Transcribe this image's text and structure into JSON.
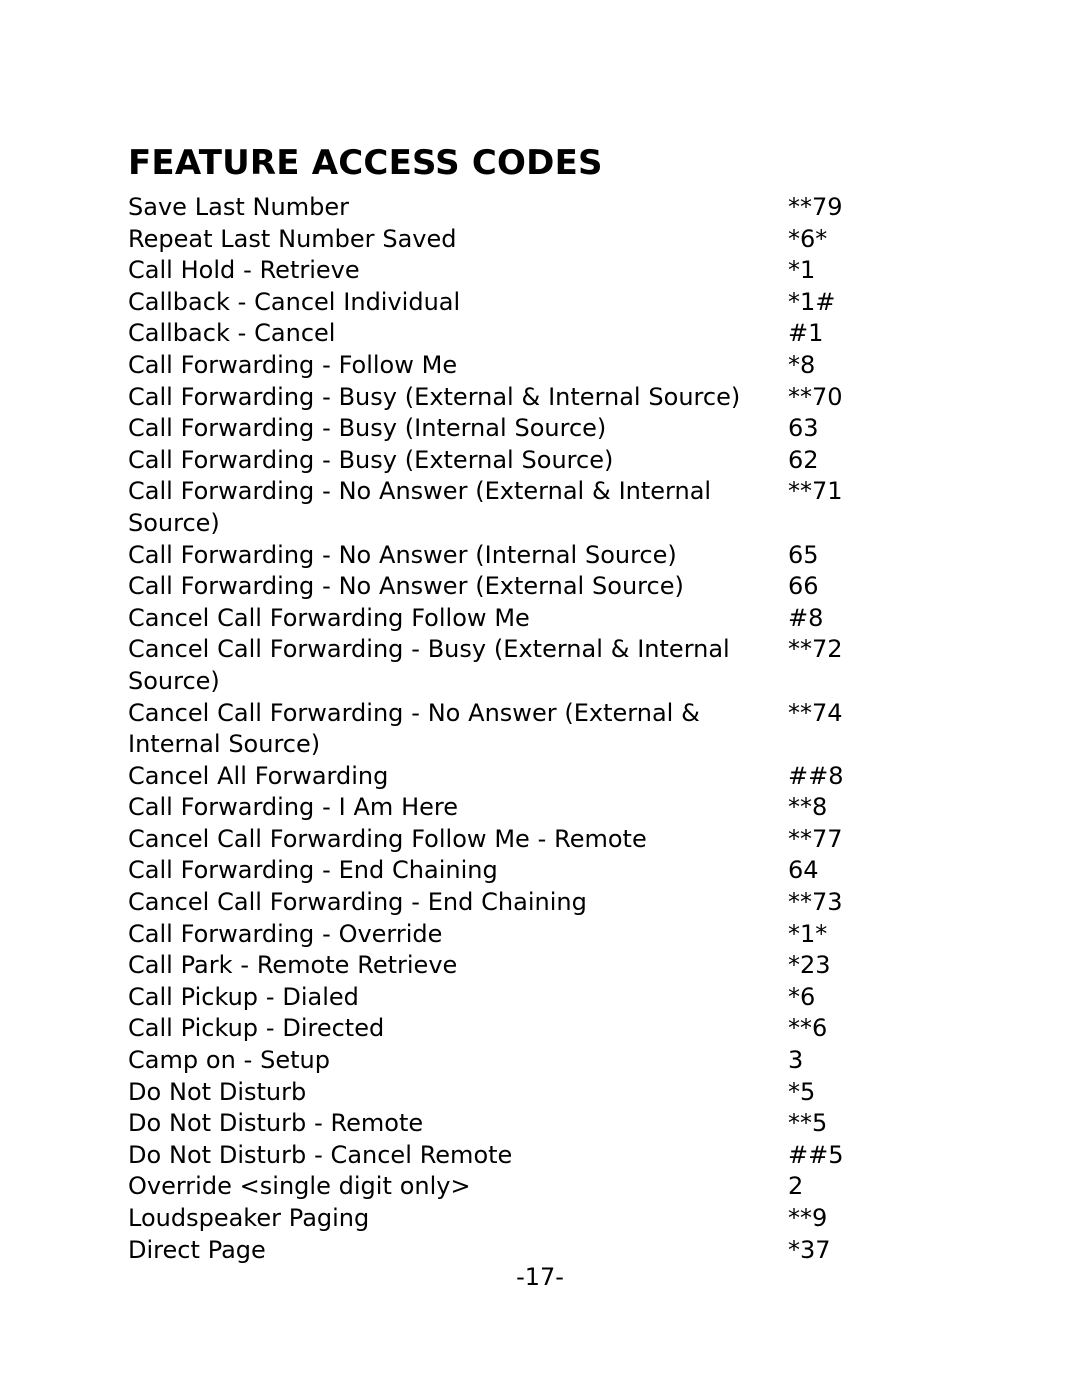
{
  "document": {
    "title": "FEATURE ACCESS CODES",
    "page_number_label": "-17-"
  },
  "feature_codes": {
    "rows": [
      {
        "feature": "Save Last Number",
        "code": "**79"
      },
      {
        "feature": "Repeat Last Number Saved",
        "code": "*6*"
      },
      {
        "feature": "Call Hold - Retrieve",
        "code": "*1"
      },
      {
        "feature": "Callback - Cancel Individual",
        "code": "*1#"
      },
      {
        "feature": "Callback - Cancel",
        "code": "#1"
      },
      {
        "feature": "Call Forwarding - Follow Me",
        "code": "*8"
      },
      {
        "feature": "Call Forwarding - Busy (External & Internal Source)",
        "code": "**70"
      },
      {
        "feature": "Call Forwarding - Busy (Internal Source)",
        "code": "63"
      },
      {
        "feature": "Call Forwarding - Busy (External Source)",
        "code": "62"
      },
      {
        "feature": "Call Forwarding - No Answer (External & Internal Source)",
        "code": "**71"
      },
      {
        "feature": "Call Forwarding - No Answer (Internal Source)",
        "code": "65"
      },
      {
        "feature": "Call Forwarding - No Answer (External Source)",
        "code": "66"
      },
      {
        "feature": "Cancel Call Forwarding Follow Me",
        "code": "#8"
      },
      {
        "feature": "Cancel Call Forwarding - Busy (External & Internal Source)",
        "code": "**72"
      },
      {
        "feature": "Cancel Call Forwarding - No Answer (External & Internal Source)",
        "code": "**74"
      },
      {
        "feature": "Cancel All Forwarding",
        "code": "##8"
      },
      {
        "feature": "Call Forwarding - I Am Here",
        "code": "**8"
      },
      {
        "feature": "Cancel Call Forwarding Follow Me - Remote",
        "code": "**77"
      },
      {
        "feature": "Call Forwarding - End Chaining",
        "code": "64"
      },
      {
        "feature": "Cancel Call Forwarding - End Chaining",
        "code": "**73"
      },
      {
        "feature": "Call Forwarding - Override",
        "code": "*1*"
      },
      {
        "feature": "Call Park - Remote Retrieve",
        "code": "*23"
      },
      {
        "feature": "Call Pickup - Dialed",
        "code": "*6"
      },
      {
        "feature": "Call Pickup - Directed",
        "code": "**6"
      },
      {
        "feature": "Camp on - Setup",
        "code": "3"
      },
      {
        "feature": "Do Not Disturb",
        "code": "*5"
      },
      {
        "feature": "Do Not Disturb - Remote",
        "code": "**5"
      },
      {
        "feature": "Do Not Disturb - Cancel Remote",
        "code": "##5"
      },
      {
        "feature": "Override <single digit only>",
        "code": "2"
      },
      {
        "feature": "Loudspeaker Paging",
        "code": "**9"
      },
      {
        "feature": "Direct Page",
        "code": "*37"
      }
    ]
  }
}
